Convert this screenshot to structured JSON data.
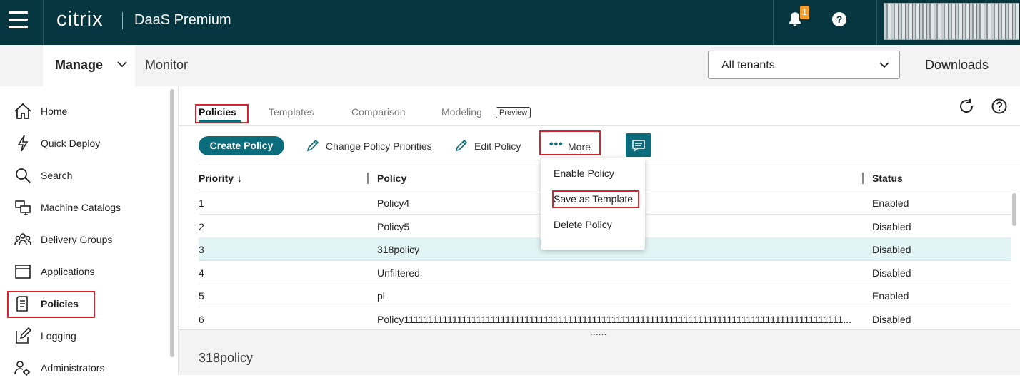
{
  "header": {
    "brand": "citrix",
    "product": "DaaS Premium",
    "notification_count": "1",
    "help_symbol": "?"
  },
  "navbar": {
    "manage_label": "Manage",
    "monitor_label": "Monitor",
    "tenant_value": "All tenants",
    "downloads_label": "Downloads"
  },
  "sidebar": {
    "items": [
      {
        "label": "Home",
        "icon": "home-icon"
      },
      {
        "label": "Quick Deploy",
        "icon": "lightning-icon"
      },
      {
        "label": "Search",
        "icon": "search-icon"
      },
      {
        "label": "Machine Catalogs",
        "icon": "machine-catalog-icon"
      },
      {
        "label": "Delivery Groups",
        "icon": "delivery-group-icon"
      },
      {
        "label": "Applications",
        "icon": "applications-icon"
      },
      {
        "label": "Policies",
        "icon": "policies-icon"
      },
      {
        "label": "Logging",
        "icon": "logging-icon"
      },
      {
        "label": "Administrators",
        "icon": "administrators-icon"
      }
    ],
    "active": "Policies"
  },
  "tabs": {
    "policies": "Policies",
    "templates": "Templates",
    "comparison": "Comparison",
    "modeling": "Modeling",
    "preview_tag": "Preview"
  },
  "toolbar": {
    "create_policy": "Create Policy",
    "change_priorities": "Change Policy Priorities",
    "edit_policy": "Edit Policy",
    "more_dots": "•••",
    "more": "More"
  },
  "table": {
    "headers": {
      "priority": "Priority",
      "policy": "Policy",
      "status": "Status"
    },
    "sort_arrow": "↓",
    "rows": [
      {
        "priority": "1",
        "policy": "Policy4",
        "status": "Enabled"
      },
      {
        "priority": "2",
        "policy": "Policy5",
        "status": "Disabled"
      },
      {
        "priority": "3",
        "policy": "318policy",
        "status": "Disabled"
      },
      {
        "priority": "4",
        "policy": "Unfiltered",
        "status": "Disabled"
      },
      {
        "priority": "5",
        "policy": "pl",
        "status": "Enabled"
      },
      {
        "priority": "6",
        "policy": "Policy1111111111111111111111111111111111111111111111111111111111111111111111111111111111111111111...",
        "status": "Disabled"
      }
    ],
    "selected_row": "3"
  },
  "more_menu": {
    "items": [
      "Enable Policy",
      "Save as Template",
      "Delete Policy"
    ]
  },
  "details": {
    "split_handle": "......",
    "title": "318policy"
  },
  "colors": {
    "header_bg": "#063741",
    "accent": "#0b6d7c",
    "highlight_box": "#d9232e",
    "selected_row": "#e2f4f5",
    "badge": "#f0a030"
  }
}
